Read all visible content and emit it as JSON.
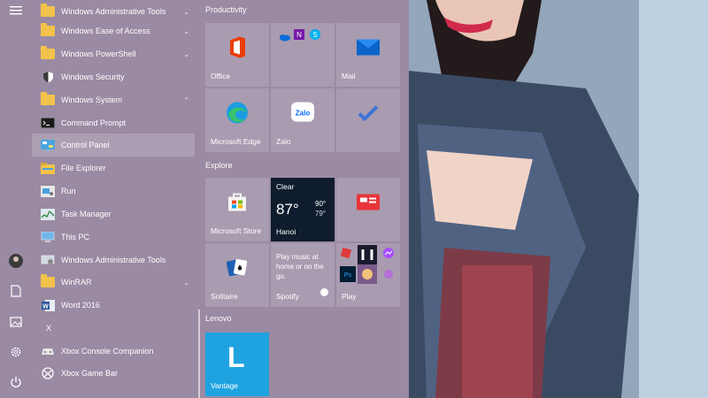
{
  "rail": {
    "icons": [
      "menu-icon",
      "user-avatar",
      "documents-icon",
      "pictures-icon",
      "settings-icon",
      "power-icon"
    ]
  },
  "apps": [
    {
      "label": "Windows Administrative Tools",
      "icon": "folder-icon",
      "chevron": "⌄"
    },
    {
      "label": "Windows Ease of Access",
      "icon": "folder-icon",
      "chevron": "⌄"
    },
    {
      "label": "Windows PowerShell",
      "icon": "folder-icon",
      "chevron": "⌄"
    },
    {
      "label": "Windows Security",
      "icon": "shield-icon",
      "chevron": ""
    },
    {
      "label": "Windows System",
      "icon": "folder-icon",
      "chevron": "⌃"
    },
    {
      "label": "Command Prompt",
      "icon": "cmd-icon",
      "chevron": ""
    },
    {
      "label": "Control Panel",
      "icon": "control-panel-icon",
      "chevron": ""
    },
    {
      "label": "File Explorer",
      "icon": "file-explorer-icon",
      "chevron": ""
    },
    {
      "label": "Run",
      "icon": "run-icon",
      "chevron": ""
    },
    {
      "label": "Task Manager",
      "icon": "task-manager-icon",
      "chevron": ""
    },
    {
      "label": "This PC",
      "icon": "this-pc-icon",
      "chevron": ""
    },
    {
      "label": "Windows Administrative Tools",
      "icon": "admin-tools-icon",
      "chevron": ""
    },
    {
      "label": "WinRAR",
      "icon": "folder-icon",
      "chevron": "⌄"
    },
    {
      "label": "Word 2016",
      "icon": "word-icon",
      "chevron": ""
    },
    {
      "label": "X",
      "icon": "",
      "chevron": ""
    },
    {
      "label": "Xbox Console Companion",
      "icon": "xbox-icon",
      "chevron": ""
    },
    {
      "label": "Xbox Game Bar",
      "icon": "xbox-game-bar-icon",
      "chevron": ""
    }
  ],
  "groups": {
    "productivity": "Productivity",
    "explore": "Explore",
    "lenovo": "Lenovo"
  },
  "tiles": {
    "office": "Office",
    "mail": "Mail",
    "edge": "Microsoft Edge",
    "zalo": "Zalo",
    "zalo_logo": "Zalo",
    "store": "Microsoft Store",
    "weather": {
      "condition": "Clear",
      "temp": "87°",
      "high": "90°",
      "low": "79°",
      "city": "Hanoi"
    },
    "solitaire": "Solitaire",
    "spotify": {
      "text": "Play music at home or on the go.",
      "label": "Spotify"
    },
    "play": "Play",
    "vantage": "Vantage",
    "vantage_logo": "L"
  },
  "colors": {
    "accent": "#0078d4",
    "folder": "#f2c24b",
    "start_bg": "#9a8aa3"
  }
}
